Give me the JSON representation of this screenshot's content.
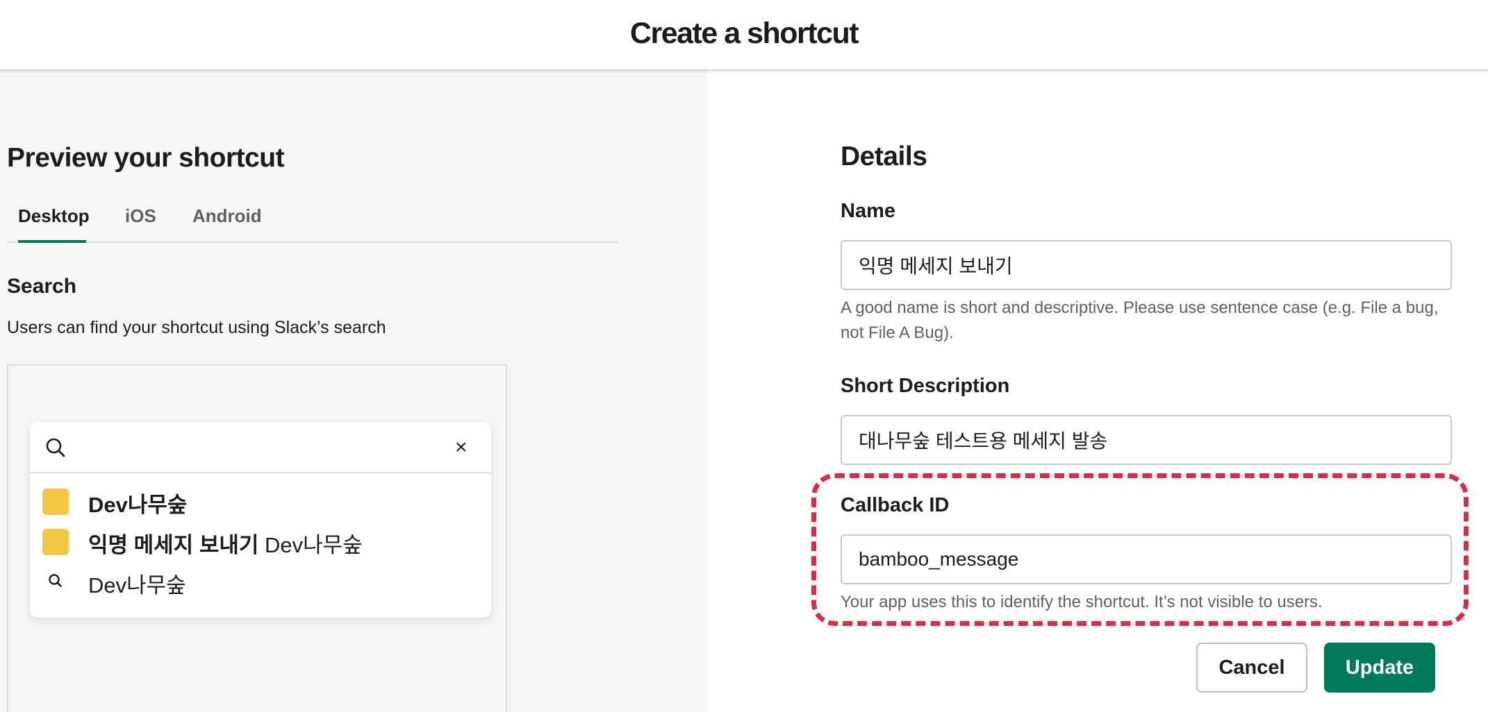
{
  "header": {
    "title": "Create a shortcut"
  },
  "preview": {
    "title": "Preview your shortcut",
    "tabs": [
      {
        "label": "Desktop",
        "active": true
      },
      {
        "label": "iOS",
        "active": false
      },
      {
        "label": "Android",
        "active": false
      }
    ],
    "search_heading": "Search",
    "search_description": "Users can find your shortcut using Slack’s search",
    "popup": {
      "search_icon": "search-icon",
      "close_glyph": "×",
      "results": [
        {
          "icon": "app-square-icon",
          "bold": "Dev나무숲",
          "normal": ""
        },
        {
          "icon": "app-square-icon",
          "bold": "익명 메세지 보내기",
          "normal": "Dev나무숲"
        },
        {
          "icon": "search-icon",
          "bold": "",
          "normal": "Dev나무숲"
        }
      ]
    }
  },
  "details": {
    "title": "Details",
    "name": {
      "label": "Name",
      "value": "익명 메세지 보내기",
      "hint": "A good name is short and descriptive. Please use sentence case (e.g. File a bug, not File A Bug)."
    },
    "short_description": {
      "label": "Short Description",
      "value": "대나무숲 테스트용 메세지 발송"
    },
    "callback_id": {
      "label": "Callback ID",
      "value": "bamboo_message",
      "hint": "Your app uses this to identify the shortcut. It’s not visible to users."
    },
    "cancel_label": "Cancel",
    "update_label": "Update"
  },
  "colors": {
    "accent": "#007a5a",
    "highlight": "#d62e45",
    "app_icon": "#f2c744"
  }
}
